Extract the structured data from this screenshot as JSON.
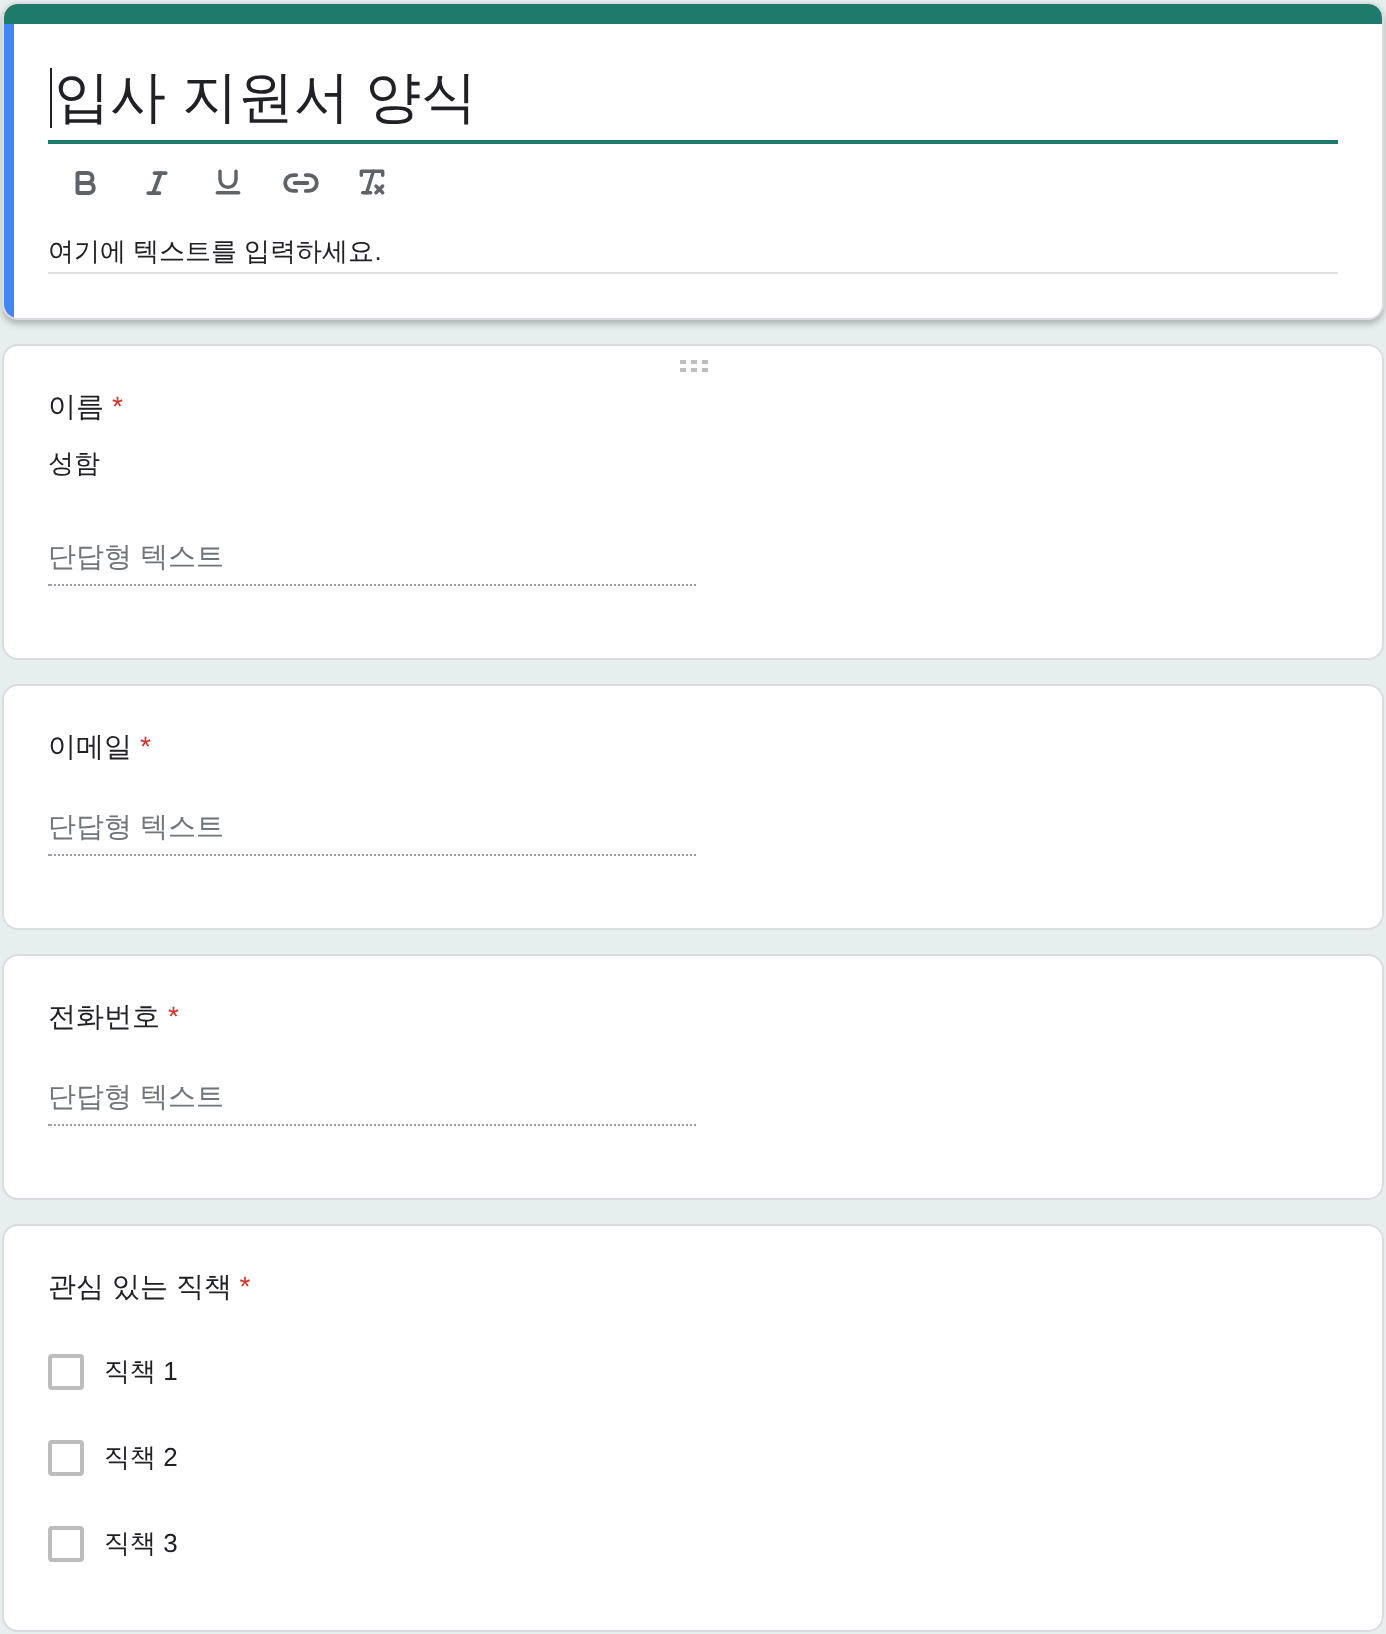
{
  "header": {
    "selected": true,
    "title": {
      "value": "입사 지원서 양식",
      "focused": true
    },
    "description": {
      "value": "여기에 텍스트를 입력하세요."
    }
  },
  "questions": [
    {
      "kind": "short_answer",
      "selected": false,
      "hovered": true,
      "title": "이름",
      "required_mark": "*",
      "description": "성함",
      "placeholder": "단답형 텍스트"
    },
    {
      "kind": "short_answer",
      "selected": false,
      "hovered": false,
      "title": "이메일",
      "required_mark": "*",
      "placeholder": "단답형 텍스트"
    },
    {
      "kind": "short_answer",
      "selected": false,
      "hovered": false,
      "title": "전화번호",
      "required_mark": "*",
      "placeholder": "단답형 텍스트"
    },
    {
      "kind": "checkboxes",
      "selected": false,
      "hovered": false,
      "title": "관심 있는 직책",
      "required_mark": "*",
      "options": [
        {
          "label": "직책 1",
          "checked": false
        },
        {
          "label": "직책 2",
          "checked": false
        },
        {
          "label": "직책 3",
          "checked": false
        }
      ]
    }
  ]
}
